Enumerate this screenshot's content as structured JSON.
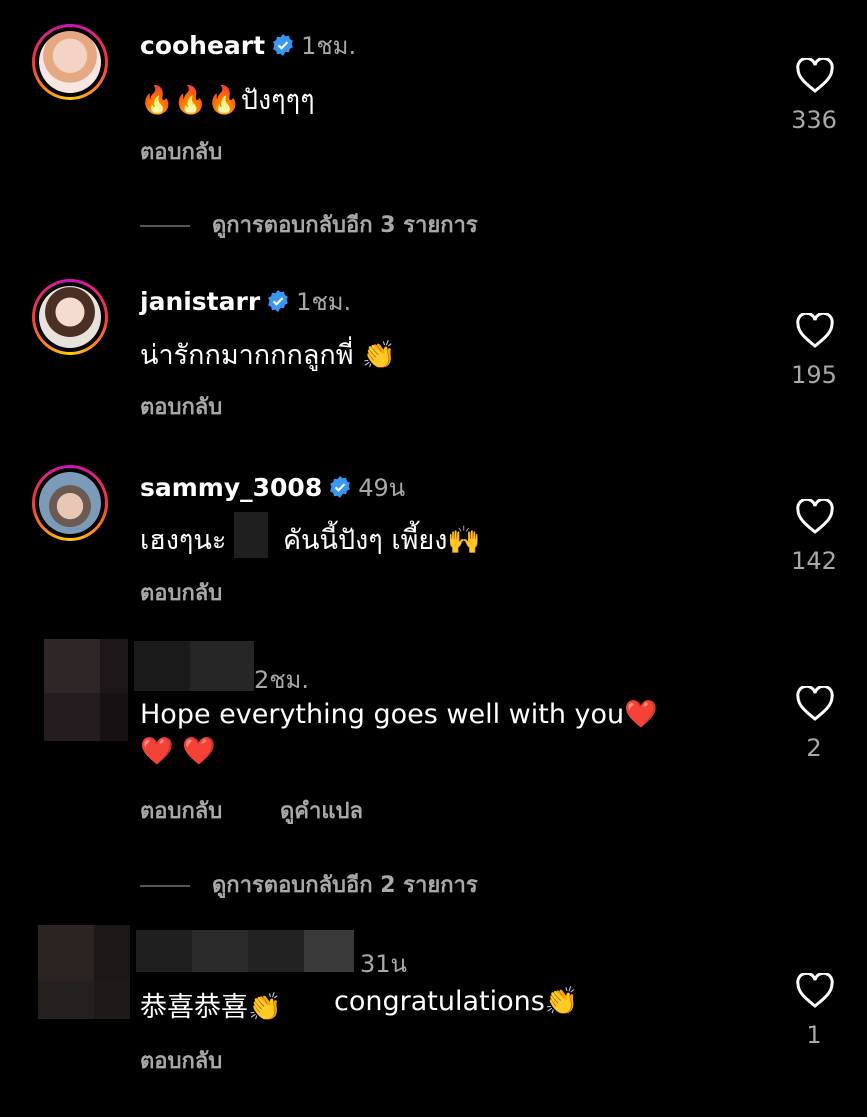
{
  "comments": [
    {
      "username": "cooheart",
      "time": "1ชม.",
      "text": "🔥🔥🔥ปังๆๆๆ",
      "reply": "ตอบกลับ",
      "likes": "336"
    },
    {
      "username": "janistarr",
      "time": "1ชม.",
      "text": "น่ารักกมากกกลูกพี่ 👏",
      "reply": "ตอบกลับ",
      "likes": "195"
    },
    {
      "username": "sammy_3008",
      "time": "49น",
      "text_a": "เฮงๆนะ",
      "text_b": "คันนี้ปังๆ เพี้ยง🙌",
      "reply": "ตอบกลับ",
      "likes": "142"
    },
    {
      "username": "",
      "time": "2ชม.",
      "text_line1": "Hope everything goes well with you❤️",
      "text_line2": "❤️ ❤️",
      "reply": "ตอบกลับ",
      "translate": "ดูคำแปล",
      "likes": "2"
    },
    {
      "username": "",
      "time": "31น",
      "text_a": "恭喜恭喜👏",
      "text_b": "congratulations👏",
      "reply": "ตอบกลับ",
      "likes": "1"
    }
  ],
  "view_more": [
    {
      "label": "ดูการตอบกลับอีก 3 รายการ"
    },
    {
      "label": "ดูการตอบกลับอีก 2 รายการ"
    }
  ],
  "colors": {
    "verified": "#3897f0",
    "secondary_text": "#a8a8a8"
  },
  "icons": {
    "like": "heart-outline-icon",
    "verified": "verified-badge-icon"
  }
}
